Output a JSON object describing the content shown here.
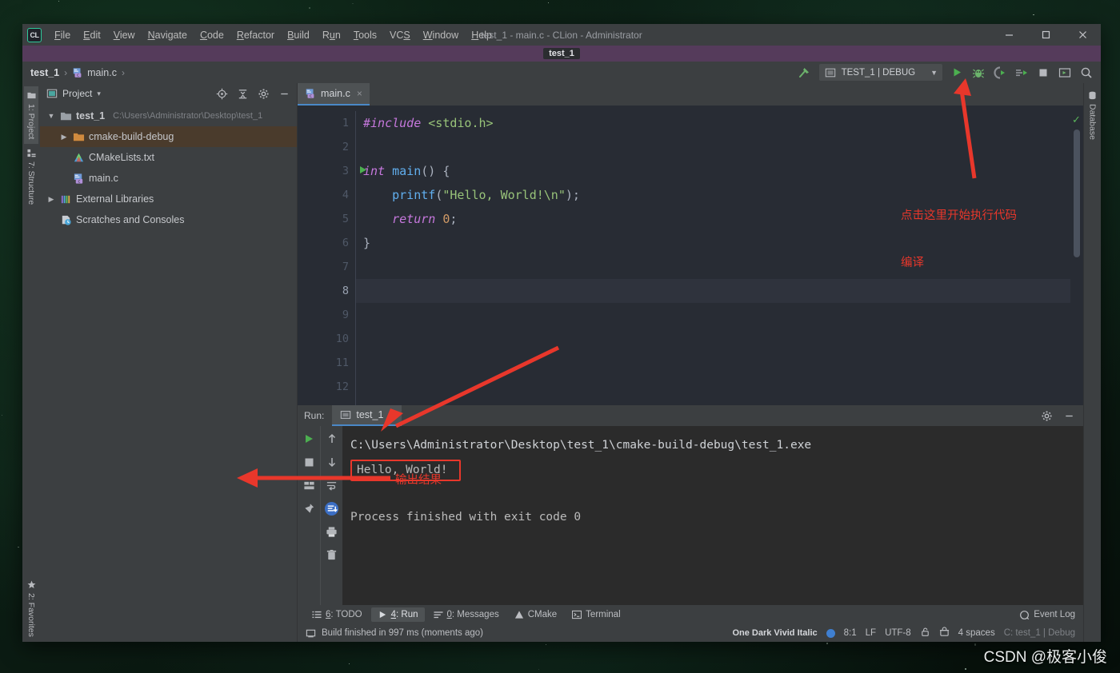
{
  "window": {
    "title": "test_1 - main.c - CLion - Administrator",
    "project_chip": "test_1",
    "logo_text": "CL"
  },
  "menu": {
    "items": [
      {
        "label": "File",
        "mnemonic": "F"
      },
      {
        "label": "Edit",
        "mnemonic": "E"
      },
      {
        "label": "View",
        "mnemonic": "V"
      },
      {
        "label": "Navigate",
        "mnemonic": "N"
      },
      {
        "label": "Code",
        "mnemonic": "C"
      },
      {
        "label": "Refactor",
        "mnemonic": "R"
      },
      {
        "label": "Build",
        "mnemonic": "B"
      },
      {
        "label": "Run",
        "mnemonic": "u"
      },
      {
        "label": "Tools",
        "mnemonic": "T"
      },
      {
        "label": "VCS",
        "mnemonic": "S"
      },
      {
        "label": "Window",
        "mnemonic": "W"
      },
      {
        "label": "Help",
        "mnemonic": "H"
      }
    ]
  },
  "window_controls": {
    "minimize": "minimize-icon",
    "maximize": "maximize-icon",
    "close": "close-icon"
  },
  "navbar": {
    "crumb_project": "test_1",
    "crumb_file": "main.c",
    "separator": "›",
    "run_config": "TEST_1 | DEBUG",
    "buttons": [
      "build-hammer-icon",
      "select-run-configuration-icon",
      "run-button",
      "debug-button",
      "run-with-coverage-button",
      "profile-button",
      "stop-button",
      "run-anything-icon",
      "search-everywhere-icon"
    ]
  },
  "left_strip": {
    "tabs": [
      {
        "label": "1: Project",
        "icon": "project-folder-icon",
        "selected": true
      },
      {
        "label": "7: Structure",
        "icon": "structure-icon",
        "selected": false
      },
      {
        "label": "2: Favorites",
        "icon": "star-icon",
        "selected": false
      }
    ]
  },
  "right_strip": {
    "tabs": [
      {
        "label": "Database",
        "icon": "database-icon"
      }
    ]
  },
  "project_panel": {
    "title": "Project",
    "dropdown": "▾",
    "icons": [
      "locate-target-icon",
      "collapse-all-icon",
      "settings-gear-icon",
      "hide-minimize-icon"
    ],
    "tree": [
      {
        "label": "test_1",
        "path": "C:\\Users\\Administrator\\Desktop\\test_1",
        "arrow": "▼",
        "indent": 0,
        "icon": "folder-icon",
        "selected": false
      },
      {
        "label": "cmake-build-debug",
        "path": "",
        "arrow": "▶",
        "indent": 1,
        "icon": "folder-orange-icon",
        "selected": true
      },
      {
        "label": "CMakeLists.txt",
        "path": "",
        "arrow": "",
        "indent": 1,
        "icon": "cmake-file-icon",
        "selected": false
      },
      {
        "label": "main.c",
        "path": "",
        "arrow": "",
        "indent": 1,
        "icon": "c-file-icon",
        "selected": false
      },
      {
        "label": "External Libraries",
        "path": "",
        "arrow": "▶",
        "indent": 0,
        "icon": "libraries-icon",
        "selected": false
      },
      {
        "label": "Scratches and Consoles",
        "path": "",
        "arrow": "",
        "indent": 0,
        "icon": "scratches-icon",
        "selected": false
      }
    ]
  },
  "editor": {
    "tab_label": "main.c",
    "tab_close": "×",
    "current_line": 8,
    "line_numbers": [
      1,
      2,
      3,
      4,
      5,
      6,
      7,
      8,
      9,
      10,
      11,
      12
    ],
    "code_lines": [
      {
        "n": 1,
        "tokens": [
          {
            "t": "#include",
            "c": "inc"
          },
          {
            "t": " ",
            "c": "pl"
          },
          {
            "t": "<stdio.h>",
            "c": "str"
          }
        ]
      },
      {
        "n": 2,
        "tokens": []
      },
      {
        "n": 3,
        "tokens": [
          {
            "t": "int",
            "c": "kw"
          },
          {
            "t": " ",
            "c": "pl"
          },
          {
            "t": "main",
            "c": "fn"
          },
          {
            "t": "() {",
            "c": "pl"
          }
        ]
      },
      {
        "n": 4,
        "tokens": [
          {
            "t": "    ",
            "c": "pl"
          },
          {
            "t": "printf",
            "c": "fn"
          },
          {
            "t": "(",
            "c": "pl"
          },
          {
            "t": "\"Hello, World!\\n\"",
            "c": "str"
          },
          {
            "t": ");",
            "c": "pl"
          }
        ]
      },
      {
        "n": 5,
        "tokens": [
          {
            "t": "    ",
            "c": "pl"
          },
          {
            "t": "return",
            "c": "kw"
          },
          {
            "t": " ",
            "c": "pl"
          },
          {
            "t": "0",
            "c": "num"
          },
          {
            "t": ";",
            "c": "pl"
          }
        ]
      },
      {
        "n": 6,
        "tokens": [
          {
            "t": "}",
            "c": "pl"
          }
        ]
      },
      {
        "n": 7,
        "tokens": []
      },
      {
        "n": 8,
        "tokens": []
      },
      {
        "n": 9,
        "tokens": []
      },
      {
        "n": 10,
        "tokens": []
      },
      {
        "n": 11,
        "tokens": []
      },
      {
        "n": 12,
        "tokens": []
      }
    ],
    "inspection_status": "ok-check-icon"
  },
  "run_panel": {
    "label": "Run:",
    "tab_label": "test_1",
    "tab_close": "×",
    "left_buttons": [
      "rerun-icon",
      "stop-icon",
      "layout-icon",
      "pin-tab-icon"
    ],
    "second_buttons": [
      "up-arrow-icon",
      "down-arrow-icon",
      "soft-wrap-icon",
      "scroll-to-end-icon",
      "print-icon",
      "clear-all-icon"
    ],
    "header_buttons": [
      "settings-gear-icon",
      "hide-minimize-icon"
    ],
    "console": [
      "C:\\Users\\Administrator\\Desktop\\test_1\\cmake-build-debug\\test_1.exe",
      "Hello, World!",
      "",
      "Process finished with exit code 0"
    ],
    "highlighted_line": "Hello, World!"
  },
  "bottom_tabs": {
    "items": [
      {
        "label": "6: TODO",
        "icon": "todo-icon",
        "selected": false
      },
      {
        "label": "4: Run",
        "icon": "run-triangle-icon",
        "selected": true
      },
      {
        "label": "0: Messages",
        "icon": "messages-icon",
        "selected": false
      },
      {
        "label": "CMake",
        "icon": "cmake-icon",
        "selected": false
      },
      {
        "label": "Terminal",
        "icon": "terminal-icon",
        "selected": false
      }
    ],
    "event_log": "Event Log"
  },
  "status_bar": {
    "build_message": "Build finished in 997 ms (moments ago)",
    "scheme": "One Dark Vivid Italic",
    "caret": "8:1",
    "line_ending": "LF",
    "encoding": "UTF-8",
    "indent": "4 spaces",
    "run_target": "C: test_1 | Debug"
  },
  "annotations": {
    "run_hint_line1": "点击这里开始执行代码",
    "run_hint_line2": "编译",
    "output_hint": "输出结果"
  },
  "watermark": "CSDN @极客小俊",
  "colors": {
    "accent_red": "#e8372b",
    "run_green": "#5ab55a",
    "tab_underline": "#4a88c7",
    "purple_bar": "#553b5b",
    "selection_orange": "#4a3b2c"
  }
}
